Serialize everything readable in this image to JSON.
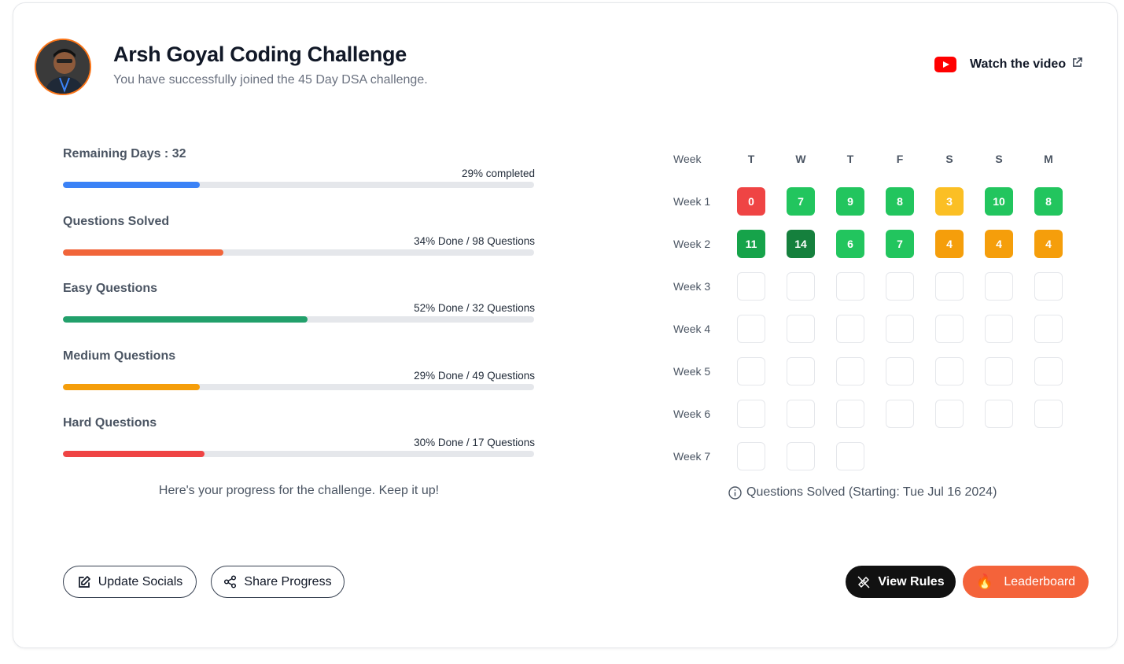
{
  "header": {
    "title": "Arsh Goyal Coding Challenge",
    "subtitle": "You have successfully joined the 45 Day DSA challenge.",
    "watch_label": "Watch the video",
    "watch_icon": "youtube-icon",
    "external_icon": "external-link-icon"
  },
  "progress": [
    {
      "label": "Remaining Days : 32",
      "text": "29% completed",
      "fraction": 0.29,
      "color": "#3b82f6"
    },
    {
      "label": "Questions Solved",
      "text": "34% Done / 98 Questions",
      "fraction": 0.34,
      "color": "#f1653a"
    },
    {
      "label": "Easy Questions",
      "text": "52% Done / 32 Questions",
      "fraction": 0.52,
      "color": "#22a06b"
    },
    {
      "label": "Medium Questions",
      "text": "29% Done / 49 Questions",
      "fraction": 0.29,
      "color": "#f59e0b"
    },
    {
      "label": "Hard Questions",
      "text": "30% Done / 17 Questions",
      "fraction": 0.3,
      "color": "#ef4444"
    }
  ],
  "footnote": "Here's your progress for the challenge. Keep it up!",
  "calendar": {
    "week_header": "Week",
    "days": [
      "T",
      "W",
      "T",
      "F",
      "S",
      "S",
      "M"
    ],
    "weeks": [
      {
        "label": "Week 1",
        "cells": [
          {
            "value": "0",
            "color": "#ef4444"
          },
          {
            "value": "7",
            "color": "#22c55e"
          },
          {
            "value": "9",
            "color": "#22c55e"
          },
          {
            "value": "8",
            "color": "#22c55e"
          },
          {
            "value": "3",
            "color": "#fbbf24"
          },
          {
            "value": "10",
            "color": "#22c55e"
          },
          {
            "value": "8",
            "color": "#22c55e"
          }
        ]
      },
      {
        "label": "Week 2",
        "cells": [
          {
            "value": "11",
            "color": "#16a34a"
          },
          {
            "value": "14",
            "color": "#15803d"
          },
          {
            "value": "6",
            "color": "#22c55e"
          },
          {
            "value": "7",
            "color": "#22c55e"
          },
          {
            "value": "4",
            "color": "#f59e0b"
          },
          {
            "value": "4",
            "color": "#f59e0b"
          },
          {
            "value": "4",
            "color": "#f59e0b"
          }
        ]
      },
      {
        "label": "Week 3",
        "cells": [
          {},
          {},
          {},
          {},
          {},
          {},
          {}
        ]
      },
      {
        "label": "Week 4",
        "cells": [
          {},
          {},
          {},
          {},
          {},
          {},
          {}
        ]
      },
      {
        "label": "Week 5",
        "cells": [
          {},
          {},
          {},
          {},
          {},
          {},
          {}
        ]
      },
      {
        "label": "Week 6",
        "cells": [
          {},
          {},
          {},
          {},
          {},
          {},
          {}
        ]
      },
      {
        "label": "Week 7",
        "cells": [
          {},
          {},
          {}
        ]
      }
    ],
    "note": "Questions Solved (Starting: Tue Jul 16 2024)",
    "note_icon": "info-icon"
  },
  "buttons": {
    "update_socials": "Update Socials",
    "share_progress": "Share Progress",
    "view_rules": "View Rules",
    "leaderboard": "Leaderboard",
    "leaderboard_icon": "🔥"
  }
}
